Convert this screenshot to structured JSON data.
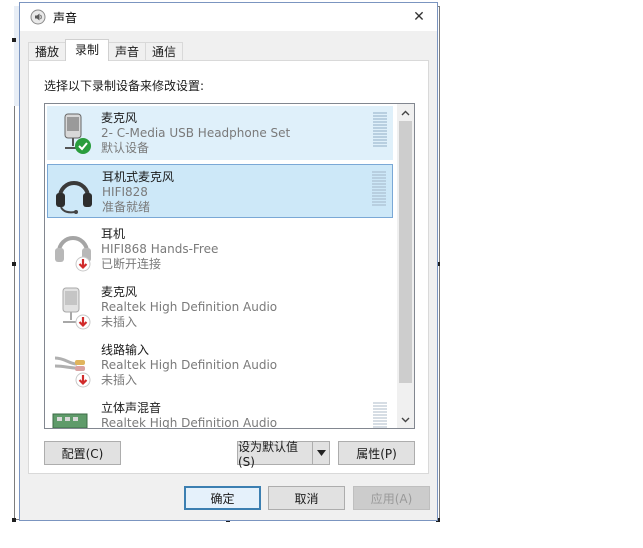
{
  "window": {
    "title": "声音",
    "close_glyph": "✕"
  },
  "tabs": [
    {
      "label": "播放",
      "active": false
    },
    {
      "label": "录制",
      "active": true
    },
    {
      "label": "声音",
      "active": false
    },
    {
      "label": "通信",
      "active": false
    }
  ],
  "instruction": "选择以下录制设备来修改设置:",
  "devices": [
    {
      "name": "麦克风",
      "description": "2- C-Media USB Headphone Set",
      "status": "默认设备",
      "icon": "microphone-icon",
      "badge": "default-check-icon",
      "state": "default"
    },
    {
      "name": "耳机式麦克风",
      "description": "HIFI828",
      "status": "准备就绪",
      "icon": "headset-icon",
      "badge": "",
      "state": "selected"
    },
    {
      "name": "耳机",
      "description": "HIFI868 Hands-Free",
      "status": "已断开连接",
      "icon": "headset-icon",
      "badge": "disconnected-icon",
      "state": "disabled"
    },
    {
      "name": "麦克风",
      "description": "Realtek High Definition Audio",
      "status": "未插入",
      "icon": "microphone-icon",
      "badge": "unplugged-icon",
      "state": "disabled"
    },
    {
      "name": "线路输入",
      "description": "Realtek High Definition Audio",
      "status": "未插入",
      "icon": "line-in-cable-icon",
      "badge": "unplugged-icon",
      "state": "disabled"
    },
    {
      "name": "立体声混音",
      "description": "Realtek High Definition Audio",
      "status": "",
      "icon": "sound-card-icon",
      "badge": "",
      "state": "disabled"
    }
  ],
  "buttons": {
    "configure": "配置(C)",
    "set_default": "设为默认值(S)",
    "properties": "属性(P)",
    "ok": "确定",
    "cancel": "取消",
    "apply": "应用(A)"
  },
  "colors": {
    "selection_fill": "#cde8f8",
    "selection_border": "#7aa8d6",
    "default_check": "#2a9d3d",
    "unplugged_arrow": "#d12b2b"
  }
}
